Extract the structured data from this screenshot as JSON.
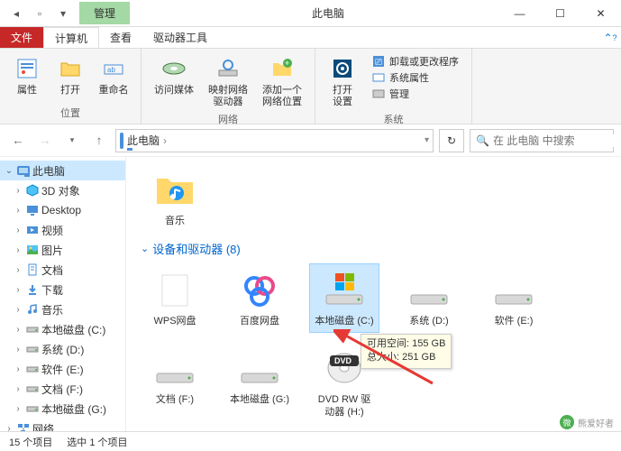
{
  "titlebar": {
    "tab_manage": "管理",
    "title": "此电脑"
  },
  "ribbon_tabs": {
    "file": "文件",
    "computer": "计算机",
    "view": "查看",
    "drive_tools": "驱动器工具"
  },
  "ribbon": {
    "loc": {
      "properties": "属性",
      "open": "打开",
      "rename": "重命名",
      "group": "位置"
    },
    "net": {
      "media": "访问媒体",
      "map_drive": "映射网络\n驱动器",
      "add_loc": "添加一个\n网络位置",
      "group": "网络"
    },
    "sys": {
      "open_settings": "打开\n设置",
      "uninstall": "卸载或更改程序",
      "sys_props": "系统属性",
      "manage": "管理",
      "group": "系统"
    }
  },
  "address": {
    "root": "此电脑",
    "search_placeholder": "在 此电脑 中搜索"
  },
  "sidebar": {
    "this_pc": "此电脑",
    "items": [
      {
        "label": "3D 对象",
        "icon": "cube"
      },
      {
        "label": "Desktop",
        "icon": "desktop"
      },
      {
        "label": "视频",
        "icon": "video"
      },
      {
        "label": "图片",
        "icon": "picture"
      },
      {
        "label": "文档",
        "icon": "document"
      },
      {
        "label": "下载",
        "icon": "download"
      },
      {
        "label": "音乐",
        "icon": "music"
      },
      {
        "label": "本地磁盘 (C:)",
        "icon": "drive"
      },
      {
        "label": "系统 (D:)",
        "icon": "drive"
      },
      {
        "label": "软件 (E:)",
        "icon": "drive"
      },
      {
        "label": "文档 (F:)",
        "icon": "drive"
      },
      {
        "label": "本地磁盘 (G:)",
        "icon": "drive"
      }
    ],
    "network": "网络"
  },
  "main": {
    "music_folder": "音乐",
    "section": "设备和驱动器 (8)",
    "drives": [
      {
        "label": "WPS网盘",
        "type": "wps"
      },
      {
        "label": "百度网盘",
        "type": "baidu"
      },
      {
        "label": "本地磁盘 (C:)",
        "type": "os",
        "selected": true
      },
      {
        "label": "系统 (D:)",
        "type": "drive"
      },
      {
        "label": "软件 (E:)",
        "type": "drive"
      },
      {
        "label": "文档 (F:)",
        "type": "drive"
      },
      {
        "label": "本地磁盘 (G:)",
        "type": "drive"
      },
      {
        "label": "DVD RW 驱动器 (H:)",
        "type": "dvd"
      }
    ]
  },
  "tooltip": {
    "line1": "可用空间: 155 GB",
    "line2": "总大小: 251 GB"
  },
  "status": {
    "count": "15 个项目",
    "selected": "选中 1 个项目"
  },
  "watermark": "熊爱好者"
}
